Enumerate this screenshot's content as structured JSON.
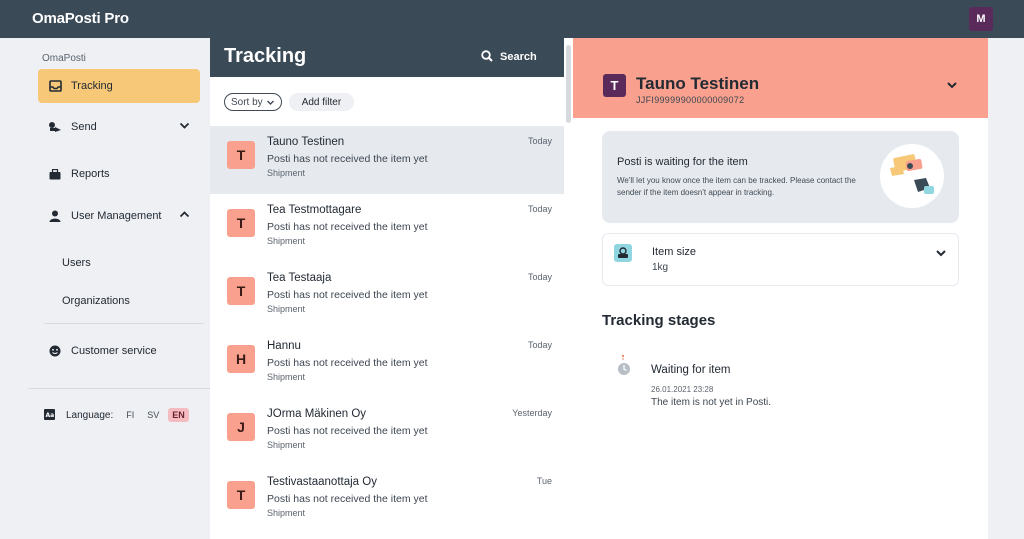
{
  "app": {
    "brand": "OmaPosti Pro",
    "user_initial": "M"
  },
  "sidebar": {
    "section_label": "OmaPosti",
    "items": [
      {
        "label": "Tracking",
        "icon": "inbox-icon"
      },
      {
        "label": "Send",
        "icon": "send-icon"
      },
      {
        "label": "Reports",
        "icon": "briefcase-icon"
      },
      {
        "label": "User Management",
        "icon": "user-icon"
      }
    ],
    "sub_items": [
      "Users",
      "Organizations"
    ],
    "customer_service": "Customer service",
    "language": {
      "label": "Language:",
      "options": [
        "FI",
        "SV",
        "EN"
      ],
      "selected": "EN"
    }
  },
  "list": {
    "title": "Tracking",
    "search_label": "Search",
    "sort_label": "Sort by",
    "add_filter_label": "Add filter",
    "rows": [
      {
        "initial": "T",
        "name": "Tauno Testinen",
        "status": "Posti has not received the item yet",
        "type": "Shipment",
        "date": "Today"
      },
      {
        "initial": "T",
        "name": "Tea Testmottagare",
        "status": "Posti has not received the item yet",
        "type": "Shipment",
        "date": "Today"
      },
      {
        "initial": "T",
        "name": "Tea Testaaja",
        "status": "Posti has not received the item yet",
        "type": "Shipment",
        "date": "Today"
      },
      {
        "initial": "H",
        "name": "Hannu",
        "status": "Posti has not received the item yet",
        "type": "Shipment",
        "date": "Today"
      },
      {
        "initial": "J",
        "name": "JOrma Mäkinen Oy",
        "status": "Posti has not received the item yet",
        "type": "Shipment",
        "date": "Yesterday"
      },
      {
        "initial": "T",
        "name": "Testivastaanottaja Oy",
        "status": "Posti has not received the item yet",
        "type": "Shipment",
        "date": "Tue"
      }
    ]
  },
  "detail": {
    "initial": "T",
    "name": "Tauno Testinen",
    "tracking_code": "JJFI99999900000009072",
    "wait_title": "Posti is waiting for the item",
    "wait_text": "We'll let you know once the item can be tracked. Please contact the sender if the item doesn't appear in tracking.",
    "size_label": "Item size",
    "size_value": "1kg",
    "stages_title": "Tracking stages",
    "stage": {
      "name": "Waiting for item",
      "time": "26.01.2021 23:28",
      "desc": "The item is not yet in Posti."
    }
  },
  "colors": {
    "topbar": "#3b4a57",
    "active_nav": "#f6c877",
    "avatar": "#f9a18e",
    "detail_header": "#f9a18e",
    "user_avatar": "#5a2a5a"
  }
}
